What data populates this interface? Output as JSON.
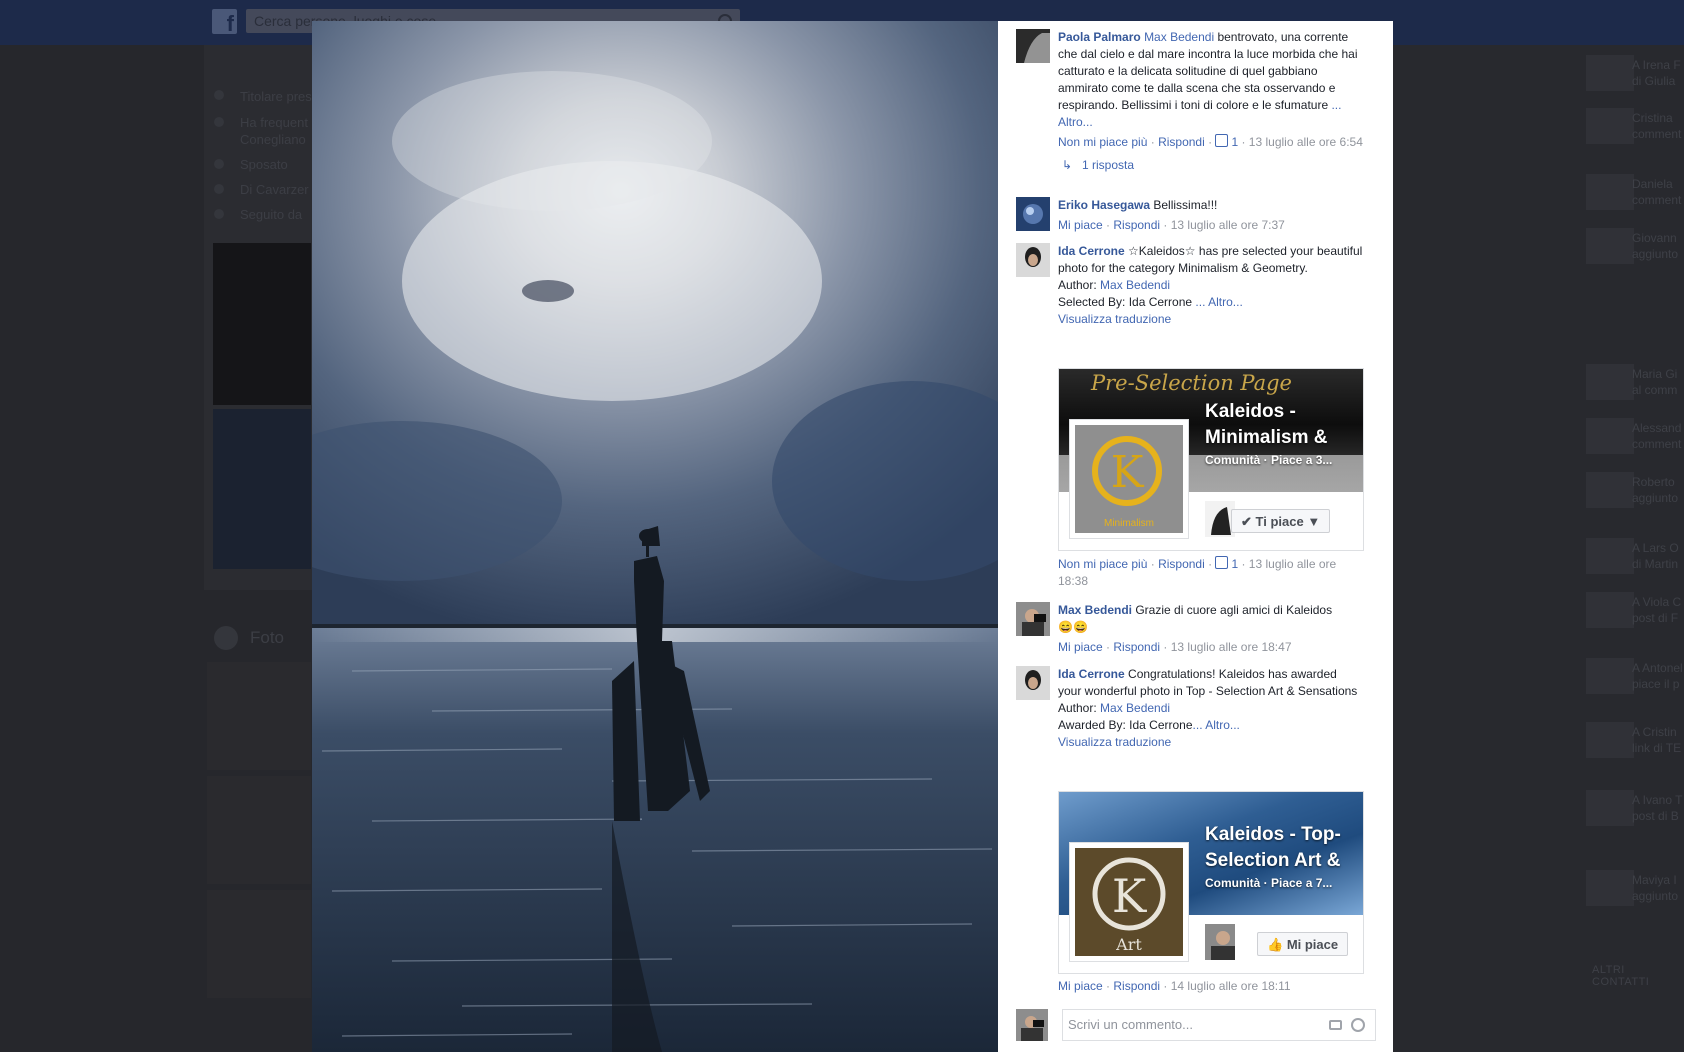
{
  "background": {
    "search_placeholder": "Cerca persone, luoghi e cose",
    "info": [
      "Titolare pres",
      "Ha frequent",
      "Conegliano",
      "Sposato",
      "Di Cavarzer",
      "Seguito da"
    ],
    "foto_title": "Foto",
    "ticker": [
      {
        "name": "A Irena F",
        "sub": "di Giulia"
      },
      {
        "name": "Cristina",
        "sub": "comment"
      },
      {
        "name": "Daniela",
        "sub": "comment"
      },
      {
        "name": "Giovann",
        "sub": "aggiunto"
      },
      {
        "name": "Maria Gi",
        "sub": "al comm"
      },
      {
        "name": "Alessand",
        "sub": "comment"
      },
      {
        "name": "Roberto",
        "sub": "aggiunto"
      },
      {
        "name": "A Lars O",
        "sub": "di Martin"
      },
      {
        "name": "A Viola C",
        "sub": "post di F"
      },
      {
        "name": "A Antonel",
        "sub": "piace il p"
      },
      {
        "name": "A Cristin",
        "sub": "link di TE"
      },
      {
        "name": "A Ivano T",
        "sub": "post di B"
      },
      {
        "name": "Maviya I",
        "sub": "aggiunto"
      }
    ],
    "altri_contatti": "ALTRI CONTATTI"
  },
  "comments": [
    {
      "author": "Paola Palmaro",
      "mention": "Max Bedendi",
      "text": " bentrovato, una corrente che dal cielo e dal mare incontra la luce morbida che hai catturato e la delicata solitudine di quel gabbiano ammirato come te dalla scena che sta osservando e respirando. Bellissimi i toni di colore e le sfumature",
      "more": "... Altro...",
      "like_label": "Non mi piace più",
      "reply_label": "Rispondi",
      "likes": "1",
      "time": "13 luglio alle ore 6:54",
      "replies": "1 risposta"
    },
    {
      "author": "Eriko Hasegawa",
      "text": " Bellissima!!!",
      "like_label": "Mi piace",
      "reply_label": "Rispondi",
      "time": "13 luglio alle ore 7:37"
    },
    {
      "author": "Ida Cerrone",
      "text": " ☆Kaleidos☆ has pre selected your beautiful photo for the category Minimalism & Geometry.",
      "author_line_label": "Author: ",
      "author_line_name": "Max Bedendi",
      "selected_by": "Selected By: Ida Cerrone ",
      "more": "... Altro...",
      "translate": "Visualizza traduzione",
      "card": {
        "banner": "Pre-Selection Page",
        "title": "Kaleidos - Minimalism &",
        "sub": "Comunità · Piace a 3...",
        "logo_caption": "Minimalism",
        "button": "Ti piace"
      },
      "like_label": "Non mi piace più",
      "reply_label": "Rispondi",
      "likes": "1",
      "time": "13 luglio alle ore 18:38"
    },
    {
      "author": "Max Bedendi",
      "text": " Grazie di cuore agli amici di Kaleidos",
      "emoji": "😄😄",
      "like_label": "Mi piace",
      "reply_label": "Rispondi",
      "time": "13 luglio alle ore 18:47"
    },
    {
      "author": "Ida Cerrone",
      "text": " Congratulations! Kaleidos has awarded your wonderful photo in Top - Selection Art & Sensations",
      "author_line_label": "Author: ",
      "author_line_name": "Max Bedendi",
      "awarded_by": "Awarded By: Ida Cerrone",
      "more": "... Altro...",
      "translate": "Visualizza traduzione",
      "card": {
        "title": "Kaleidos - Top-Selection Art &",
        "sub": "Comunità · Piace a 7...",
        "logo_caption": "Art",
        "button": "Mi piace"
      },
      "like_label": "Mi piace",
      "reply_label": "Rispondi",
      "time": "14 luglio alle ore 18:11"
    }
  ],
  "reply_placeholder": "Scrivi un commento...",
  "colors": {
    "link": "#4267b2",
    "author": "#365899",
    "meta": "#90949c"
  }
}
